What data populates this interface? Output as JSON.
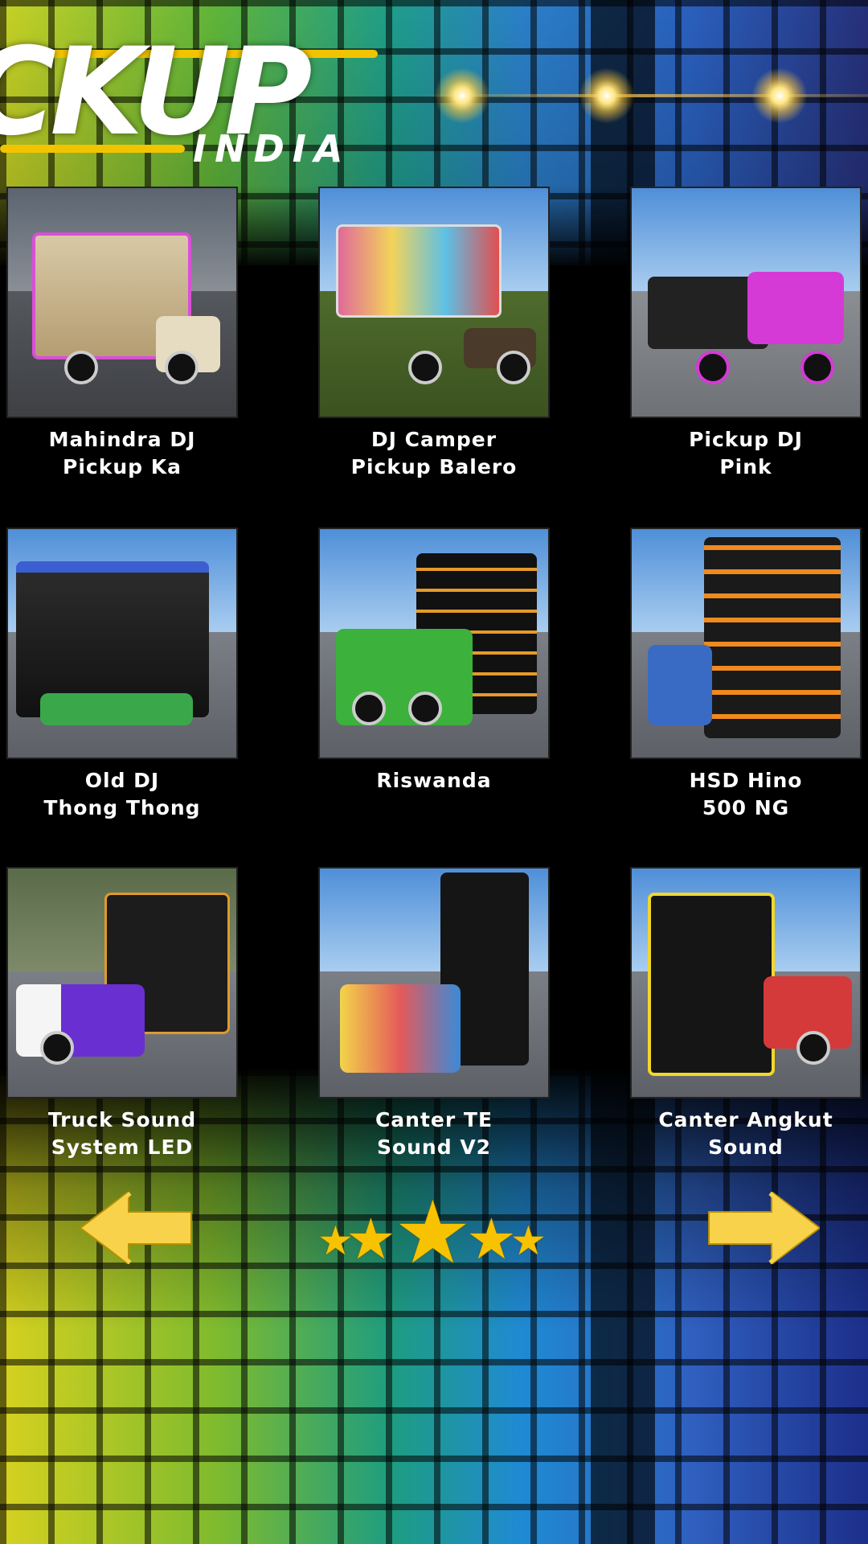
{
  "logo": {
    "main_text": "CKUP",
    "sub_text": "INDIA"
  },
  "colors": {
    "accent_yellow": "#f7c200",
    "card_label": "#ffffff",
    "background": "#000000"
  },
  "cards": [
    {
      "label": "Mahindra DJ\nPickup Ka",
      "thumb_theme": "cream-truck"
    },
    {
      "label": "DJ Camper\nPickup Balero",
      "thumb_theme": "brown-truck"
    },
    {
      "label": "Pickup DJ\nPink",
      "thumb_theme": "pink-truck"
    },
    {
      "label": "Old DJ\nThong Thong",
      "thumb_theme": "stage-truck"
    },
    {
      "label": "Riswanda",
      "thumb_theme": "green-truck"
    },
    {
      "label": "HSD Hino\n500 NG",
      "thumb_theme": "orange-speakers"
    },
    {
      "label": "Truck Sound\nSystem LED",
      "thumb_theme": "purple-truck"
    },
    {
      "label": "Canter TE\nSound V2",
      "thumb_theme": "yellow-tower"
    },
    {
      "label": "Canter Angkut\nSound",
      "thumb_theme": "black-yellow-speakers"
    }
  ],
  "controls": {
    "prev_icon": "left-arrow-icon",
    "next_icon": "right-arrow-icon",
    "rate_icon": "five-stars-icon"
  }
}
